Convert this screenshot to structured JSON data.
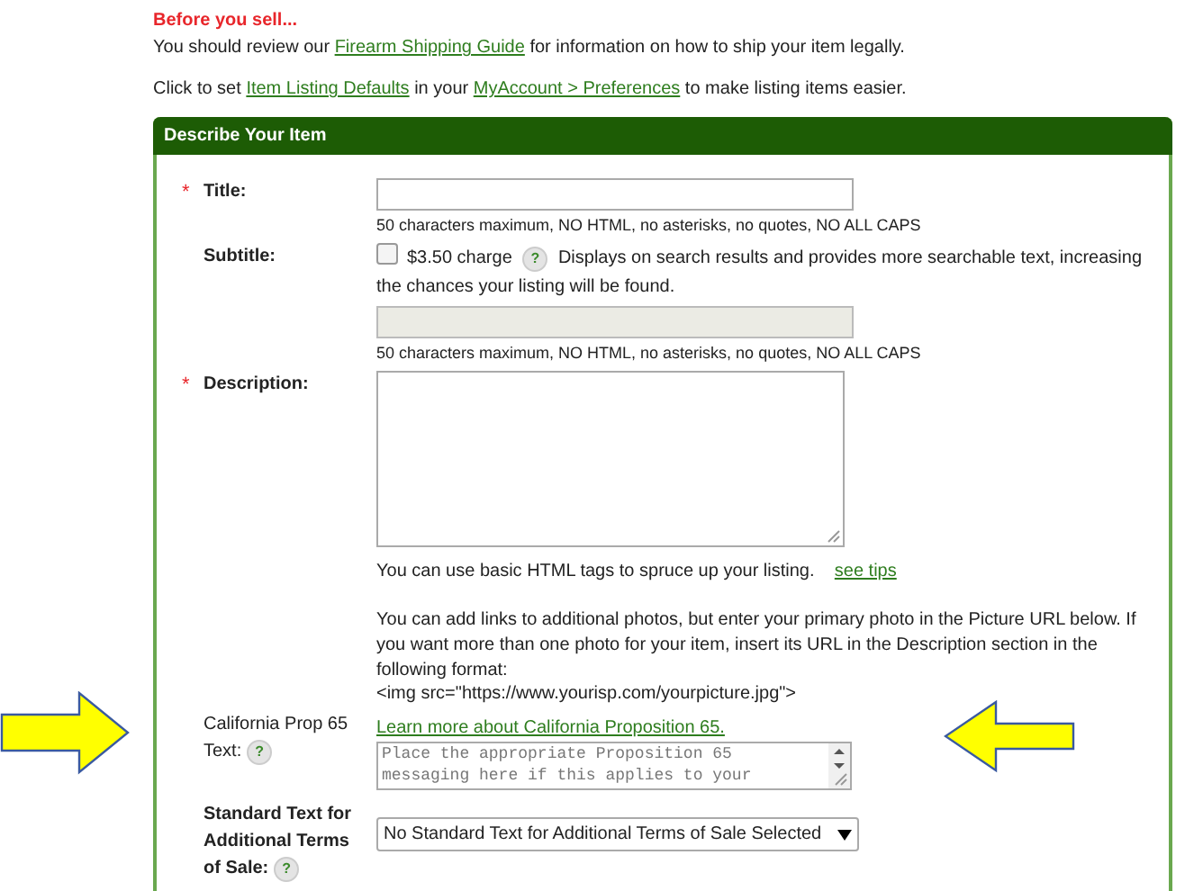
{
  "notice": {
    "heading": "Before you sell...",
    "lines": [
      [
        {
          "kind": "text",
          "text": "You should review our "
        },
        {
          "kind": "link",
          "text": "Firearm Shipping Guide"
        },
        {
          "kind": "text",
          "text": " for information on how to ship your item legally."
        }
      ],
      [
        {
          "kind": "text",
          "text": "Click to set "
        },
        {
          "kind": "link",
          "text": "Item Listing Defaults"
        },
        {
          "kind": "text",
          "text": " in your "
        },
        {
          "kind": "link",
          "text": "MyAccount > Preferences"
        },
        {
          "kind": "text",
          "text": " to make listing items easier."
        }
      ]
    ]
  },
  "panel": {
    "title": "Describe Your Item",
    "fields": [
      {
        "kind": "input",
        "required_mark": "*",
        "label": "Title:",
        "hint": "50 characters maximum, NO HTML, no asterisks, no quotes, NO ALL CAPS"
      },
      {
        "kind": "subtitle",
        "label": "Subtitle:",
        "checked": false,
        "charge": "$3.50 charge",
        "help": "?",
        "note": "Displays on search results and provides more searchable text, increasing the chances your listing will be found.",
        "disabled": true,
        "hint": "50 characters maximum, NO HTML, no asterisks, no quotes, NO ALL CAPS"
      },
      {
        "kind": "description",
        "required_mark": "*",
        "label": "Description:",
        "tip": "You can use basic HTML tags to spruce up your listing.",
        "tip_link": "see tips",
        "paragraph": "You can add links to additional photos, but enter your primary photo in the Picture URL below. If you want more than one photo for your item, insert its URL in the Description section in the following format:",
        "example": "<img src=\"https://www.yourisp.com/yourpicture.jpg\">"
      },
      {
        "kind": "prop65",
        "label": "California Prop 65 Text:",
        "help": "?",
        "link": "Learn more about California Proposition 65.",
        "placeholder": "Place the appropriate Proposition 65 messaging here if this applies to your"
      },
      {
        "kind": "select",
        "label": "Standard Text for Additional Terms of Sale:",
        "help": "?",
        "value": "No Standard Text for Additional Terms of Sale Selected"
      }
    ]
  }
}
